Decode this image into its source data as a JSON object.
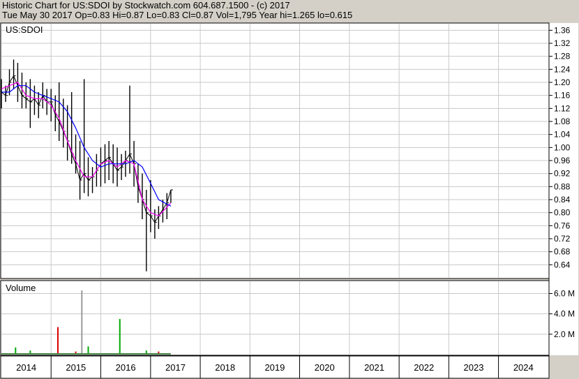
{
  "header": {
    "line1": "Historic Chart for US:SDOI by Stockwatch.com 604.687.1500 - (c) 2017",
    "line2": "Tue May 30 2017  Op=0.83  Hi=0.87  Lo=0.83  Cl=0.87  Vol=1,795  Year hi=1.265  lo=0.615"
  },
  "colors": {
    "background": "#ffffff",
    "frame": "#d4d0c8",
    "grid": "#c8c8c8",
    "price_bar": "#000000",
    "ma_short": "#ff00ff",
    "ma_long": "#0000ff",
    "volume_up": "#00aa00",
    "volume_down": "#dd0000",
    "volume_neutral": "#9a9a9a"
  },
  "chart_data": [
    {
      "type": "line",
      "panel": "price",
      "symbol_label": "US:SDOI",
      "ylim": [
        0.6,
        1.38
      ],
      "yticks": [
        1.36,
        1.32,
        1.28,
        1.24,
        1.2,
        1.16,
        1.12,
        1.08,
        1.04,
        1.0,
        0.96,
        0.92,
        0.88,
        0.84,
        0.8,
        0.76,
        0.72,
        0.68,
        0.64
      ],
      "xlim": [
        "2014-01-01",
        "2025-01-01"
      ],
      "x_tick_labels": [
        "2014",
        "2015",
        "2016",
        "2017",
        "2018",
        "2019",
        "2020",
        "2021",
        "2022",
        "2023",
        "2024"
      ],
      "grid": true,
      "series": [
        {
          "style": "hlc-bars",
          "x": [
            "2014-01-01",
            "2014-02-01",
            "2014-03-01",
            "2014-04-01",
            "2014-05-01",
            "2014-06-01",
            "2014-07-01",
            "2014-08-01",
            "2014-09-01",
            "2014-10-01",
            "2014-11-01",
            "2014-12-01",
            "2015-01-01",
            "2015-02-01",
            "2015-03-01",
            "2015-04-01",
            "2015-05-01",
            "2015-06-01",
            "2015-07-01",
            "2015-08-01",
            "2015-09-01",
            "2015-10-01",
            "2015-11-01",
            "2015-12-01",
            "2016-01-01",
            "2016-02-01",
            "2016-03-01",
            "2016-04-01",
            "2016-05-01",
            "2016-06-01",
            "2016-07-01",
            "2016-08-01",
            "2016-09-01",
            "2016-10-01",
            "2016-11-01",
            "2016-12-01",
            "2017-01-01",
            "2017-02-01",
            "2017-03-01",
            "2017-04-01",
            "2017-05-01",
            "2017-05-30"
          ],
          "high": [
            1.21,
            1.19,
            1.24,
            1.27,
            1.26,
            1.23,
            1.2,
            1.21,
            1.19,
            1.17,
            1.2,
            1.18,
            1.18,
            1.16,
            1.2,
            1.15,
            1.13,
            1.17,
            1.04,
            1.02,
            1.21,
            0.97,
            0.94,
            0.98,
            1.0,
            1.01,
            1.02,
            1.01,
            1.0,
            0.98,
            0.99,
            1.19,
            1.02,
            0.95,
            0.92,
            0.87,
            0.9,
            0.81,
            0.82,
            0.84,
            0.86,
            0.87
          ],
          "low": [
            1.12,
            1.14,
            1.16,
            1.18,
            1.14,
            1.12,
            1.12,
            1.06,
            1.1,
            1.09,
            1.12,
            1.1,
            1.08,
            1.05,
            1.02,
            1.0,
            0.96,
            0.95,
            0.92,
            0.84,
            0.86,
            0.85,
            0.86,
            0.88,
            0.88,
            0.89,
            0.9,
            0.89,
            0.88,
            0.9,
            0.91,
            0.92,
            0.88,
            0.83,
            0.78,
            0.62,
            0.74,
            0.72,
            0.75,
            0.77,
            0.78,
            0.83
          ],
          "close": [
            1.17,
            1.16,
            1.2,
            1.22,
            1.19,
            1.16,
            1.15,
            1.14,
            1.15,
            1.13,
            1.16,
            1.14,
            1.14,
            1.1,
            1.08,
            1.05,
            1.02,
            0.98,
            0.95,
            0.9,
            0.92,
            0.9,
            0.91,
            0.93,
            0.95,
            0.96,
            0.97,
            0.95,
            0.93,
            0.94,
            0.96,
            0.98,
            0.95,
            0.88,
            0.84,
            0.8,
            0.79,
            0.77,
            0.79,
            0.81,
            0.83,
            0.87
          ]
        },
        {
          "style": "line",
          "color_key": "ma_short",
          "x": [
            "2014-01-01",
            "2014-03-01",
            "2014-05-01",
            "2014-07-01",
            "2014-09-01",
            "2014-11-01",
            "2015-01-01",
            "2015-03-01",
            "2015-05-01",
            "2015-07-01",
            "2015-09-01",
            "2015-11-01",
            "2016-01-01",
            "2016-03-01",
            "2016-05-01",
            "2016-07-01",
            "2016-09-01",
            "2016-11-01",
            "2017-01-01",
            "2017-03-01",
            "2017-05-30"
          ],
          "values": [
            1.18,
            1.19,
            1.2,
            1.16,
            1.15,
            1.15,
            1.13,
            1.09,
            1.02,
            0.96,
            0.91,
            0.91,
            0.95,
            0.96,
            0.94,
            0.96,
            0.95,
            0.84,
            0.8,
            0.79,
            0.83
          ]
        },
        {
          "style": "line",
          "color_key": "ma_long",
          "x": [
            "2014-01-01",
            "2014-03-01",
            "2014-05-01",
            "2014-07-01",
            "2014-09-01",
            "2014-11-01",
            "2015-01-01",
            "2015-03-01",
            "2015-05-01",
            "2015-07-01",
            "2015-09-01",
            "2015-11-01",
            "2016-01-01",
            "2016-03-01",
            "2016-05-01",
            "2016-07-01",
            "2016-09-01",
            "2016-11-01",
            "2017-01-01",
            "2017-03-01",
            "2017-05-30"
          ],
          "values": [
            1.17,
            1.17,
            1.19,
            1.19,
            1.17,
            1.16,
            1.15,
            1.14,
            1.11,
            1.06,
            1.0,
            0.96,
            0.94,
            0.95,
            0.95,
            0.95,
            0.96,
            0.94,
            0.89,
            0.84,
            0.82
          ]
        }
      ]
    },
    {
      "type": "bar",
      "panel": "volume",
      "title": "Volume",
      "ylim": [
        0,
        7.2
      ],
      "yticks": [
        6.0,
        4.0,
        2.0
      ],
      "ytick_labels": [
        "6.0 M",
        "4.0 M",
        "2.0 M"
      ],
      "xlim": [
        "2014-01-01",
        "2025-01-01"
      ],
      "grid": true,
      "x": [
        "2014-04-15",
        "2014-08-01",
        "2015-02-20",
        "2015-07-01",
        "2015-08-15",
        "2015-10-01",
        "2016-05-20",
        "2016-12-01",
        "2017-03-01"
      ],
      "values": [
        0.7,
        0.4,
        2.7,
        0.3,
        6.3,
        0.8,
        3.5,
        0.4,
        0.3
      ],
      "color_keys": [
        "volume_up",
        "volume_up",
        "volume_down",
        "volume_down",
        "volume_neutral",
        "volume_up",
        "volume_up",
        "volume_up",
        "volume_down"
      ]
    }
  ]
}
